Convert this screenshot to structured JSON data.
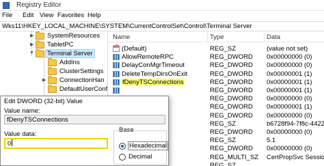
{
  "window": {
    "title": "Registry Editor"
  },
  "menu": [
    "File",
    "Edit",
    "View",
    "Favorites",
    "Help"
  ],
  "address": "Wks11\\HKEY_LOCAL_MACHINE\\SYSTEM\\CurrentControlSet\\Control\\Terminal Server",
  "tree": {
    "items": [
      {
        "label": "SystemResources",
        "expanded": false,
        "selected": false
      },
      {
        "label": "TabletPC",
        "expanded": false,
        "selected": false
      },
      {
        "label": "Terminal Server",
        "expanded": true,
        "selected": true
      },
      {
        "label": "AddIns",
        "expanded": false,
        "selected": false
      },
      {
        "label": "ClusterSettings",
        "expanded": false,
        "selected": false
      },
      {
        "label": "ConnectionHan",
        "expanded": false,
        "selected": false
      },
      {
        "label": "DefaultUserConf",
        "expanded": false,
        "selected": false
      }
    ]
  },
  "list": {
    "columns": [
      "Name",
      "Type",
      "Data"
    ],
    "rows": [
      {
        "name": "(Default)",
        "type": "REG_SZ",
        "data": "(value not set)",
        "kind": "sz"
      },
      {
        "name": "AllowRemoteRPC",
        "type": "REG_DWORD",
        "data": "0x00000000 (0)",
        "kind": "dword"
      },
      {
        "name": "DelayConMgrTimeout",
        "type": "REG_DWORD",
        "data": "0x00000000 (0)",
        "kind": "dword"
      },
      {
        "name": "DeleteTempDirsOnExit",
        "type": "REG_DWORD",
        "data": "0x00000001 (1)",
        "kind": "dword"
      },
      {
        "name": "fDenyTSConnections",
        "type": "REG_DWORD",
        "data": "0x00000001 (1)",
        "kind": "dword",
        "highlight": true
      },
      {
        "name": "",
        "type": "REG_DWORD",
        "data": "0x00000001 (1)",
        "kind": "dword"
      },
      {
        "name": "",
        "type": "REG_DWORD",
        "data": "0x00000000 (0)",
        "kind": "dword"
      },
      {
        "name": "",
        "type": "REG_DWORD",
        "data": "0x00000001 (1)",
        "kind": "dword"
      },
      {
        "name": "",
        "type": "REG_DWORD",
        "data": "0x00000000 (0)",
        "kind": "dword"
      },
      {
        "name": "",
        "type": "REG_SZ",
        "data": "b6728f94-7f8c-4422-95",
        "kind": "sz"
      },
      {
        "name": "",
        "type": "REG_DWORD",
        "data": "0x00000000 (0)",
        "kind": "dword"
      },
      {
        "name": "",
        "type": "REG_SZ",
        "data": "5.1",
        "kind": "sz"
      },
      {
        "name": "",
        "type": "REG_DWORD",
        "data": "0x00000000 (0)",
        "kind": "dword"
      },
      {
        "name": "",
        "type": "REG_MULTI_SZ",
        "data": "CertPropSvc SessionEn",
        "kind": "sz"
      },
      {
        "name": "",
        "type": "REG_SZ",
        "data": "",
        "kind": "sz"
      }
    ]
  },
  "dialog": {
    "title": "Edit DWORD (32-bit) Value",
    "value_name_label": "Value name:",
    "value_name": "fDenyTSConnections",
    "value_data_label": "Value data:",
    "value_data": "0",
    "base_label": "Base",
    "base_options": [
      {
        "label": "Hexadecimal",
        "selected": true
      },
      {
        "label": "Decimal",
        "selected": false
      }
    ]
  }
}
